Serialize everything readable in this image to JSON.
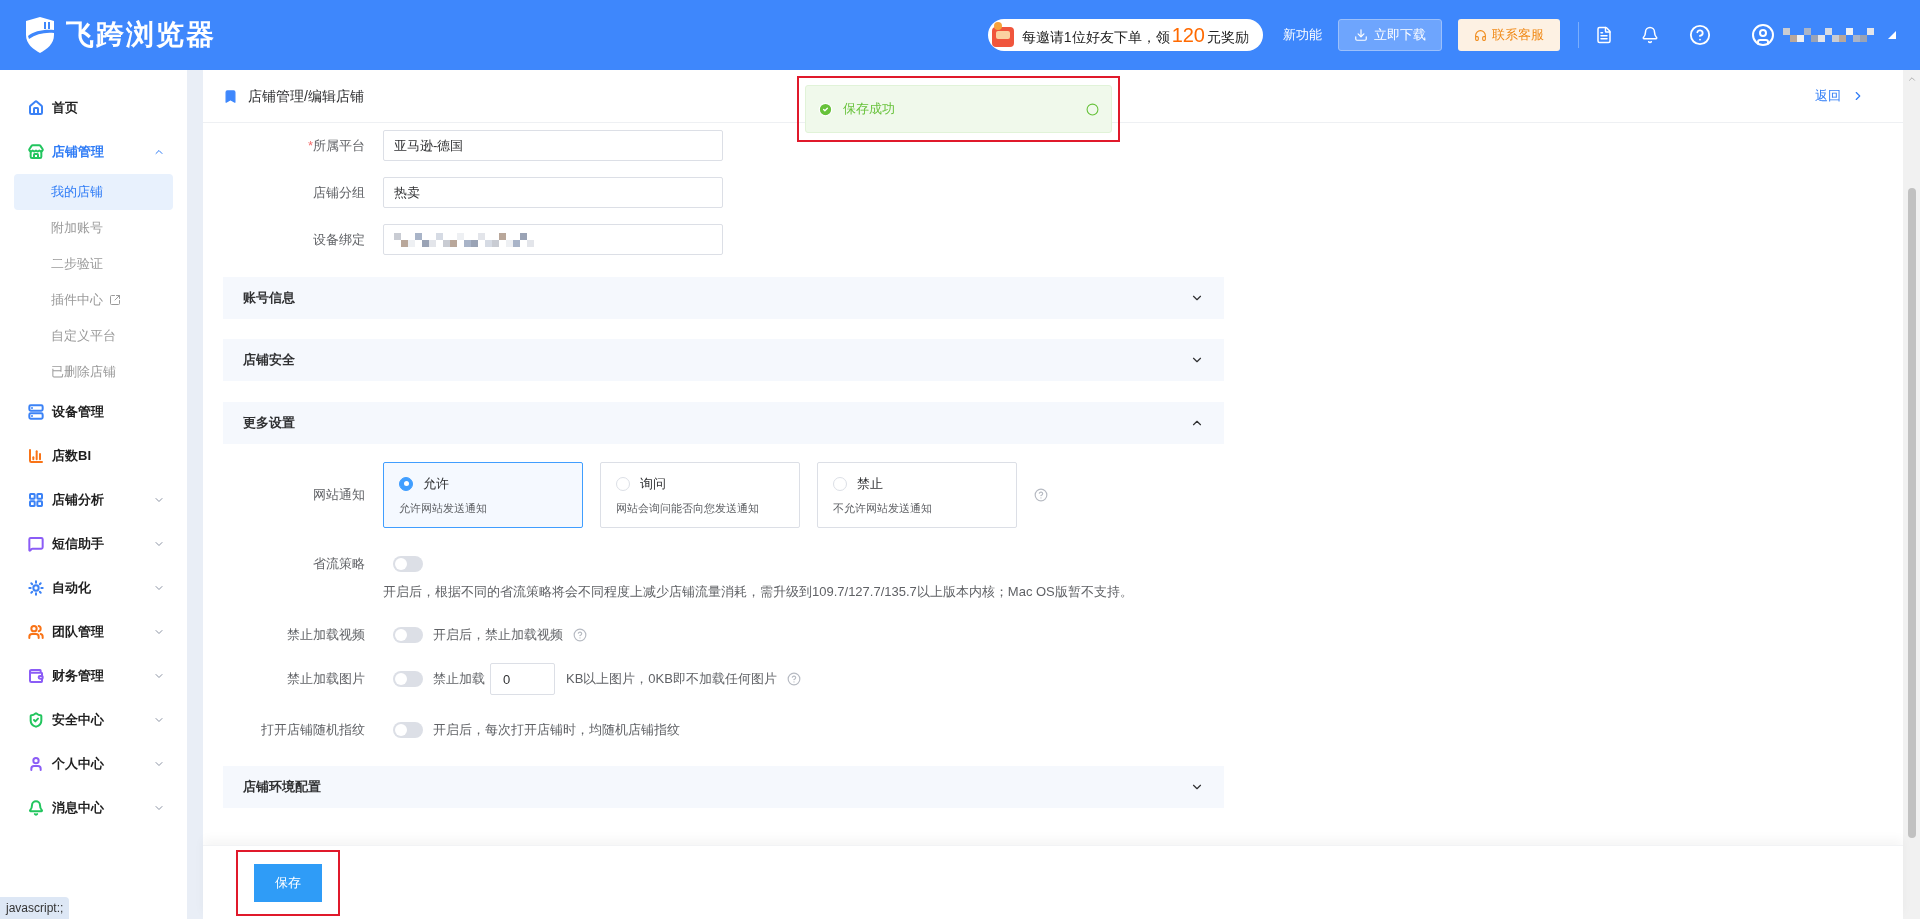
{
  "header": {
    "logo_text": "飞跨浏览器",
    "promo": {
      "prefix": "每邀请1位好友下单，领",
      "amount": "120",
      "suffix": "元奖励"
    },
    "new_features": "新功能",
    "download": "立即下载",
    "support": "联系客服"
  },
  "sidebar": {
    "items": [
      {
        "label": "首页",
        "kind": "link",
        "color": "#3b82f6"
      },
      {
        "label": "店铺管理",
        "kind": "group",
        "color": "#22c55e",
        "expanded": true,
        "children": [
          {
            "label": "我的店铺",
            "selected": true,
            "external": false
          },
          {
            "label": "附加账号",
            "selected": false,
            "external": false
          },
          {
            "label": "二步验证",
            "selected": false,
            "external": false
          },
          {
            "label": "插件中心",
            "selected": false,
            "external": true
          },
          {
            "label": "自定义平台",
            "selected": false,
            "external": false
          },
          {
            "label": "已删除店铺",
            "selected": false,
            "external": false
          }
        ]
      },
      {
        "label": "设备管理",
        "kind": "link",
        "color": "#3b82f6"
      },
      {
        "label": "店数BI",
        "kind": "link",
        "color": "#f97316"
      },
      {
        "label": "店铺分析",
        "kind": "group",
        "color": "#3b82f6",
        "expanded": false
      },
      {
        "label": "短信助手",
        "kind": "group",
        "color": "#8b5cf6",
        "expanded": false
      },
      {
        "label": "自动化",
        "kind": "group",
        "color": "#3b82f6",
        "expanded": false
      },
      {
        "label": "团队管理",
        "kind": "group",
        "color": "#f97316",
        "expanded": false
      },
      {
        "label": "财务管理",
        "kind": "group",
        "color": "#8b5cf6",
        "expanded": false
      },
      {
        "label": "安全中心",
        "kind": "group",
        "color": "#22c55e",
        "expanded": false
      },
      {
        "label": "个人中心",
        "kind": "group",
        "color": "#8b5cf6",
        "expanded": false
      },
      {
        "label": "消息中心",
        "kind": "group",
        "color": "#22c55e",
        "expanded": false
      }
    ]
  },
  "page": {
    "breadcrumb": "店铺管理/编辑店铺",
    "back": "返回"
  },
  "toast": {
    "message": "保存成功"
  },
  "fields": [
    {
      "label": "所属平台",
      "required_mark": "*",
      "kind": "text",
      "value": "亚马逊-德国"
    },
    {
      "label": "店铺分组",
      "kind": "text",
      "value": "热卖"
    },
    {
      "label": "设备绑定",
      "kind": "redacted"
    }
  ],
  "sections": [
    {
      "title": "账号信息",
      "expanded": false
    },
    {
      "title": "店铺安全",
      "expanded": false
    },
    {
      "title": "更多设置",
      "expanded": true
    },
    {
      "title": "店铺环境配置",
      "expanded": false
    }
  ],
  "more_settings": {
    "notification": {
      "label": "网站通知",
      "options": [
        {
          "title": "允许",
          "desc": "允许网站发送通知",
          "selected": true
        },
        {
          "title": "询问",
          "desc": "网站会询问能否向您发送通知",
          "selected": false
        },
        {
          "title": "禁止",
          "desc": "不允许网站发送通知",
          "selected": false
        }
      ]
    },
    "toggles": [
      {
        "kind": "note-below",
        "label": "省流策略",
        "on": false,
        "note": "开启后，根据不同的省流策略将会不同程度上减少店铺流量消耗，需升级到109.7/127.7/135.7以上版本内核；Mac OS版暂不支持。"
      },
      {
        "kind": "note-inline",
        "label": "禁止加载视频",
        "on": false,
        "note": "开启后，禁止加载视频",
        "help": true
      },
      {
        "kind": "input",
        "label": "禁止加载图片",
        "on": false,
        "prefix": "禁止加载",
        "value": "0",
        "suffix": "KB以上图片，0KB即不加载任何图片",
        "help": true
      },
      {
        "kind": "note-inline",
        "label": "打开店铺随机指纹",
        "on": false,
        "note": "开启后，每次打开店铺时，均随机店铺指纹",
        "help": false
      }
    ]
  },
  "save": "保存",
  "status_tip": "javascript:;"
}
